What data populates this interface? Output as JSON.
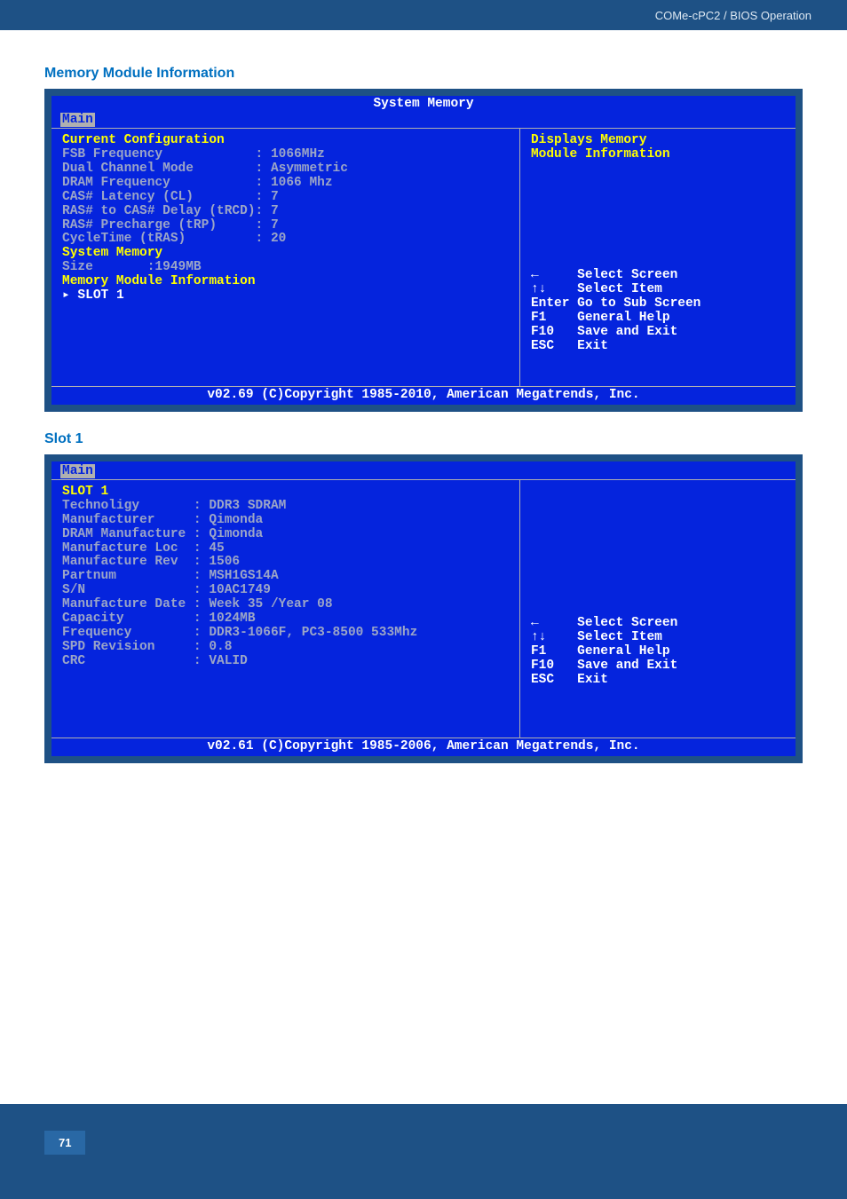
{
  "header": {
    "breadcrumb": "COMe-cPC2 / BIOS Operation"
  },
  "section1": {
    "title": "Memory Module Information",
    "bios_title": "System Memory",
    "tab": "Main",
    "left_content": {
      "heading1": "Current Configuration",
      "rows": [
        {
          "label": "FSB Frequency",
          "value": "1066MHz"
        },
        {
          "label": "Dual Channel Mode",
          "value": "Asymmetric"
        },
        {
          "label": "DRAM Frequency",
          "value": "1066 Mhz"
        },
        {
          "label": "CAS# Latency (CL)",
          "value": "7"
        },
        {
          "label": "RAS# to CAS# Delay (tRCD)",
          "value": "7"
        },
        {
          "label": "RAS# Precharge (tRP)",
          "value": "7"
        },
        {
          "label": "CycleTime (tRAS)",
          "value": "20"
        }
      ],
      "heading2": "System Memory",
      "size_label": "Size",
      "size_value": ":1949MB",
      "heading3": "Memory Module Information",
      "slot_label": "▸ SLOT 1"
    },
    "right_top": "Displays Memory\nModule Information",
    "right_bottom": "←     Select Screen\n↑↓    Select Item\nEnter Go to Sub Screen\nF1    General Help\nF10   Save and Exit\nESC   Exit",
    "footer": "v02.69 (C)Copyright 1985-2010, American Megatrends, Inc."
  },
  "section2": {
    "title": "Slot 1",
    "tab": "Main",
    "left_content": {
      "heading": "SLOT 1",
      "rows": [
        {
          "label": "Technoligy",
          "value": "DDR3 SDRAM"
        },
        {
          "label": "Manufacturer",
          "value": "Qimonda"
        },
        {
          "label": "DRAM Manufacture",
          "value": "Qimonda"
        },
        {
          "label": "Manufacture Loc",
          "value": "45"
        },
        {
          "label": "Manufacture Rev",
          "value": "1506"
        },
        {
          "label": "Partnum",
          "value": "MSH1GS14A"
        },
        {
          "label": "S/N",
          "value": "10AC1749"
        },
        {
          "label": "Manufacture Date",
          "value": "Week 35 /Year 08"
        },
        {
          "label": "Capacity",
          "value": "1024MB"
        },
        {
          "label": "Frequency",
          "value": "DDR3-1066F, PC3-8500 533Mhz"
        },
        {
          "label": "SPD Revision",
          "value": "0.8"
        },
        {
          "label": "CRC",
          "value": "VALID"
        }
      ]
    },
    "right_bottom": "←     Select Screen\n↑↓    Select Item\nF1    General Help\nF10   Save and Exit\nESC   Exit",
    "footer": "v02.61 (C)Copyright 1985-2006, American Megatrends, Inc."
  },
  "page_number": "71"
}
